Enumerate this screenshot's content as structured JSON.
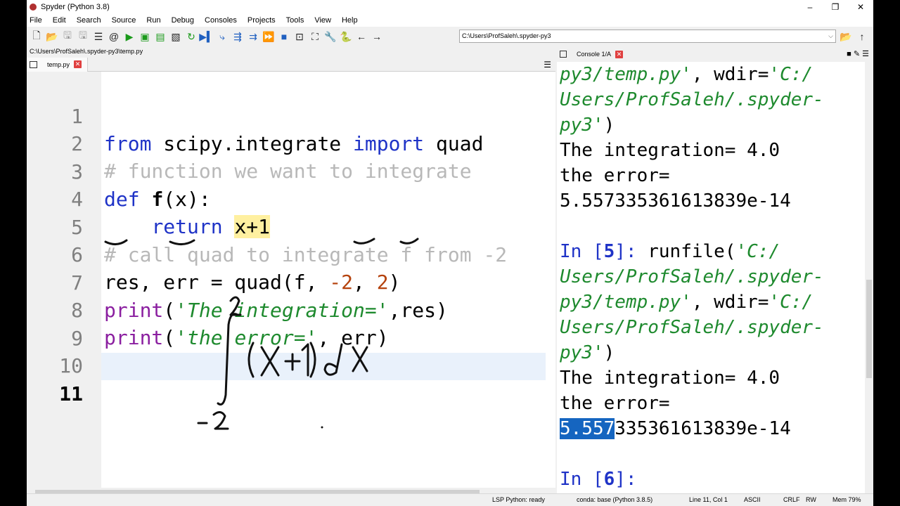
{
  "window": {
    "title": "Spyder (Python 3.8)",
    "minimize": "–",
    "restore": "❐",
    "close": "✕"
  },
  "menu": [
    "File",
    "Edit",
    "Search",
    "Source",
    "Run",
    "Debug",
    "Consoles",
    "Projects",
    "Tools",
    "View",
    "Help"
  ],
  "toolbar": {
    "working_dir": "C:\\Users\\ProfSaleh\\.spyder-py3"
  },
  "file_path": "C:\\Users\\ProfSaleh\\.spyder-py3\\temp.py",
  "editor": {
    "tab_label": "temp.py",
    "current_line": 11,
    "lines": [
      {
        "n": "1"
      },
      {
        "n": "2",
        "comment": "# function we want to integrate"
      },
      {
        "n": "3"
      },
      {
        "n": "4"
      },
      {
        "n": "5",
        "comment": "# call quad to integrate f from -2"
      },
      {
        "n": "6"
      },
      {
        "n": "7",
        "string": "'The integration='"
      },
      {
        "n": "8",
        "string": "'the error='"
      },
      {
        "n": "9"
      },
      {
        "n": "10"
      },
      {
        "n": "11"
      }
    ]
  },
  "console": {
    "tab_label": "Console 1/A",
    "lines": [
      "py3/temp.py', wdir='C:/",
      "Users/ProfSaleh/.spyder-",
      "py3')",
      "The integration= 4.0",
      "the error=",
      "5.557335361613839e-14",
      "",
      "In [5]: runfile('C:/",
      "Users/ProfSaleh/.spyder-",
      "py3/temp.py', wdir='C:/",
      "Users/ProfSaleh/.spyder-",
      "py3')",
      "The integration= 4.0",
      "the error=",
      "5.557335361613839e-14",
      "",
      "In [6]:"
    ],
    "selected_text": "5.557",
    "rest_text": "335361613839e-14"
  },
  "status": {
    "lsp": "LSP Python: ready",
    "conda": "conda: base (Python 3.8.5)",
    "position": "Line 11, Col 1",
    "encoding": "ASCII",
    "eol": "CRLF",
    "rw": "RW",
    "mem": "Mem 79%"
  },
  "annotation": {
    "upper_limit": "2",
    "lower_limit": "-2",
    "integrand": "(x+1) dx"
  }
}
